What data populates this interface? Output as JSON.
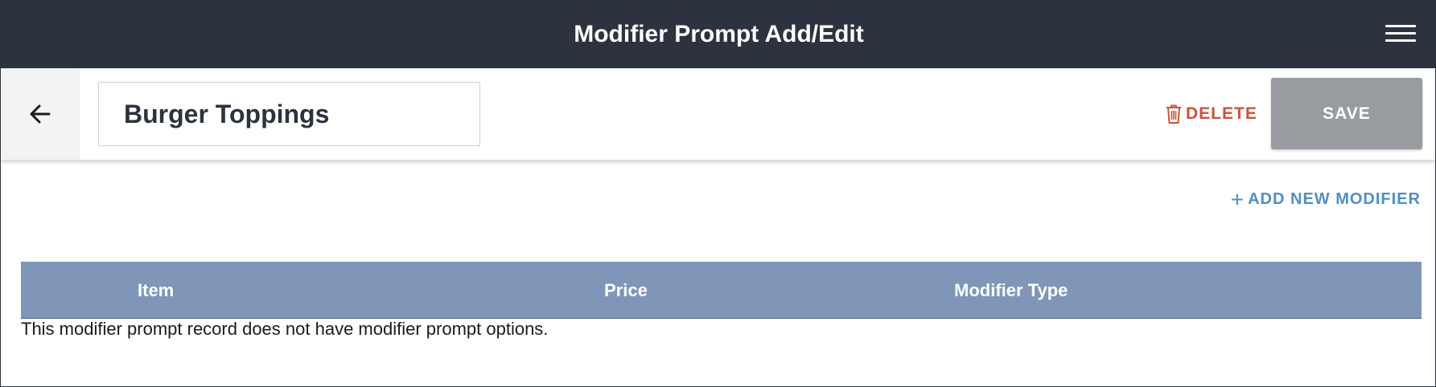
{
  "header": {
    "title": "Modifier Prompt Add/Edit",
    "menu_icon": "hamburger-menu-icon"
  },
  "toolbar": {
    "back_icon": "arrow-left-icon",
    "name_value": "Burger Toppings",
    "delete_label": "DELETE",
    "delete_icon": "trash-icon",
    "save_label": "SAVE"
  },
  "content": {
    "add_modifier_label": "ADD NEW MODIFIER",
    "add_modifier_icon": "plus-icon",
    "table": {
      "columns": [
        "Item",
        "Price",
        "Modifier Type"
      ],
      "empty_message": "This modifier prompt record does not have modifier prompt options."
    }
  },
  "colors": {
    "header_bg": "#2c333e",
    "table_header_bg": "#7f96b8",
    "delete": "#c8553d",
    "link": "#4f8fc5",
    "save_disabled": "#989ca0"
  }
}
